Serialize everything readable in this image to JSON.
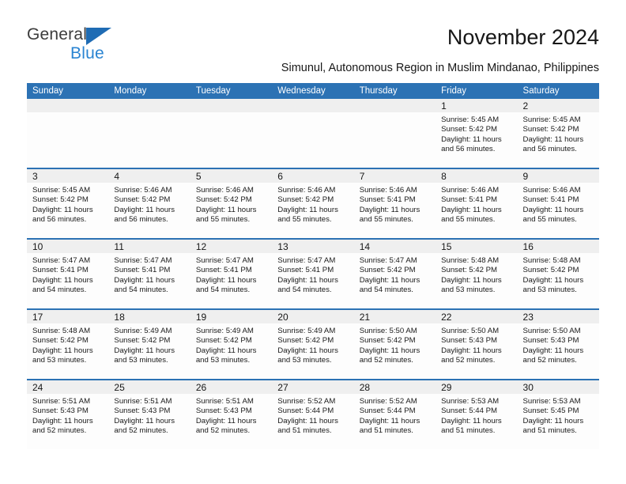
{
  "logo": {
    "word_one": "General",
    "word_two": "Blue",
    "triangle_icon": "blue-triangle-icon",
    "brand_blue": "#2a84d2",
    "triangle_blue": "#1f6cb4"
  },
  "header": {
    "title": "November 2024",
    "subtitle": "Simunul, Autonomous Region in Muslim Mindanao, Philippines"
  },
  "calendar": {
    "header_color": "#2c72b4",
    "band_color": "#efefef",
    "weekdays": [
      "Sunday",
      "Monday",
      "Tuesday",
      "Wednesday",
      "Thursday",
      "Friday",
      "Saturday"
    ],
    "weeks": [
      [
        {
          "day": "",
          "empty": true
        },
        {
          "day": "",
          "empty": true
        },
        {
          "day": "",
          "empty": true
        },
        {
          "day": "",
          "empty": true
        },
        {
          "day": "",
          "empty": true
        },
        {
          "day": "1",
          "sunrise": "Sunrise: 5:45 AM",
          "sunset": "Sunset: 5:42 PM",
          "daylight": "Daylight: 11 hours and 56 minutes."
        },
        {
          "day": "2",
          "sunrise": "Sunrise: 5:45 AM",
          "sunset": "Sunset: 5:42 PM",
          "daylight": "Daylight: 11 hours and 56 minutes."
        }
      ],
      [
        {
          "day": "3",
          "sunrise": "Sunrise: 5:45 AM",
          "sunset": "Sunset: 5:42 PM",
          "daylight": "Daylight: 11 hours and 56 minutes."
        },
        {
          "day": "4",
          "sunrise": "Sunrise: 5:46 AM",
          "sunset": "Sunset: 5:42 PM",
          "daylight": "Daylight: 11 hours and 56 minutes."
        },
        {
          "day": "5",
          "sunrise": "Sunrise: 5:46 AM",
          "sunset": "Sunset: 5:42 PM",
          "daylight": "Daylight: 11 hours and 55 minutes."
        },
        {
          "day": "6",
          "sunrise": "Sunrise: 5:46 AM",
          "sunset": "Sunset: 5:42 PM",
          "daylight": "Daylight: 11 hours and 55 minutes."
        },
        {
          "day": "7",
          "sunrise": "Sunrise: 5:46 AM",
          "sunset": "Sunset: 5:41 PM",
          "daylight": "Daylight: 11 hours and 55 minutes."
        },
        {
          "day": "8",
          "sunrise": "Sunrise: 5:46 AM",
          "sunset": "Sunset: 5:41 PM",
          "daylight": "Daylight: 11 hours and 55 minutes."
        },
        {
          "day": "9",
          "sunrise": "Sunrise: 5:46 AM",
          "sunset": "Sunset: 5:41 PM",
          "daylight": "Daylight: 11 hours and 55 minutes."
        }
      ],
      [
        {
          "day": "10",
          "sunrise": "Sunrise: 5:47 AM",
          "sunset": "Sunset: 5:41 PM",
          "daylight": "Daylight: 11 hours and 54 minutes."
        },
        {
          "day": "11",
          "sunrise": "Sunrise: 5:47 AM",
          "sunset": "Sunset: 5:41 PM",
          "daylight": "Daylight: 11 hours and 54 minutes."
        },
        {
          "day": "12",
          "sunrise": "Sunrise: 5:47 AM",
          "sunset": "Sunset: 5:41 PM",
          "daylight": "Daylight: 11 hours and 54 minutes."
        },
        {
          "day": "13",
          "sunrise": "Sunrise: 5:47 AM",
          "sunset": "Sunset: 5:41 PM",
          "daylight": "Daylight: 11 hours and 54 minutes."
        },
        {
          "day": "14",
          "sunrise": "Sunrise: 5:47 AM",
          "sunset": "Sunset: 5:42 PM",
          "daylight": "Daylight: 11 hours and 54 minutes."
        },
        {
          "day": "15",
          "sunrise": "Sunrise: 5:48 AM",
          "sunset": "Sunset: 5:42 PM",
          "daylight": "Daylight: 11 hours and 53 minutes."
        },
        {
          "day": "16",
          "sunrise": "Sunrise: 5:48 AM",
          "sunset": "Sunset: 5:42 PM",
          "daylight": "Daylight: 11 hours and 53 minutes."
        }
      ],
      [
        {
          "day": "17",
          "sunrise": "Sunrise: 5:48 AM",
          "sunset": "Sunset: 5:42 PM",
          "daylight": "Daylight: 11 hours and 53 minutes."
        },
        {
          "day": "18",
          "sunrise": "Sunrise: 5:49 AM",
          "sunset": "Sunset: 5:42 PM",
          "daylight": "Daylight: 11 hours and 53 minutes."
        },
        {
          "day": "19",
          "sunrise": "Sunrise: 5:49 AM",
          "sunset": "Sunset: 5:42 PM",
          "daylight": "Daylight: 11 hours and 53 minutes."
        },
        {
          "day": "20",
          "sunrise": "Sunrise: 5:49 AM",
          "sunset": "Sunset: 5:42 PM",
          "daylight": "Daylight: 11 hours and 53 minutes."
        },
        {
          "day": "21",
          "sunrise": "Sunrise: 5:50 AM",
          "sunset": "Sunset: 5:42 PM",
          "daylight": "Daylight: 11 hours and 52 minutes."
        },
        {
          "day": "22",
          "sunrise": "Sunrise: 5:50 AM",
          "sunset": "Sunset: 5:43 PM",
          "daylight": "Daylight: 11 hours and 52 minutes."
        },
        {
          "day": "23",
          "sunrise": "Sunrise: 5:50 AM",
          "sunset": "Sunset: 5:43 PM",
          "daylight": "Daylight: 11 hours and 52 minutes."
        }
      ],
      [
        {
          "day": "24",
          "sunrise": "Sunrise: 5:51 AM",
          "sunset": "Sunset: 5:43 PM",
          "daylight": "Daylight: 11 hours and 52 minutes."
        },
        {
          "day": "25",
          "sunrise": "Sunrise: 5:51 AM",
          "sunset": "Sunset: 5:43 PM",
          "daylight": "Daylight: 11 hours and 52 minutes."
        },
        {
          "day": "26",
          "sunrise": "Sunrise: 5:51 AM",
          "sunset": "Sunset: 5:43 PM",
          "daylight": "Daylight: 11 hours and 52 minutes."
        },
        {
          "day": "27",
          "sunrise": "Sunrise: 5:52 AM",
          "sunset": "Sunset: 5:44 PM",
          "daylight": "Daylight: 11 hours and 51 minutes."
        },
        {
          "day": "28",
          "sunrise": "Sunrise: 5:52 AM",
          "sunset": "Sunset: 5:44 PM",
          "daylight": "Daylight: 11 hours and 51 minutes."
        },
        {
          "day": "29",
          "sunrise": "Sunrise: 5:53 AM",
          "sunset": "Sunset: 5:44 PM",
          "daylight": "Daylight: 11 hours and 51 minutes."
        },
        {
          "day": "30",
          "sunrise": "Sunrise: 5:53 AM",
          "sunset": "Sunset: 5:45 PM",
          "daylight": "Daylight: 11 hours and 51 minutes."
        }
      ]
    ]
  }
}
